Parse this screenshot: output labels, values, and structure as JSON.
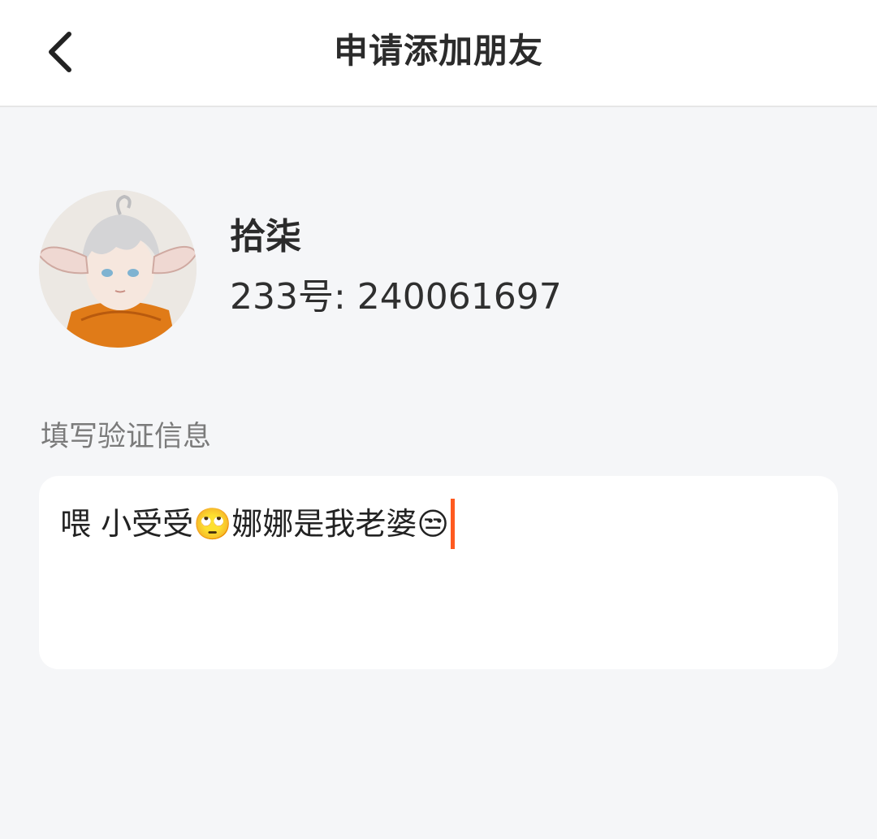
{
  "header": {
    "title": "申请添加朋友",
    "back_icon": "chevron-left-icon"
  },
  "profile": {
    "name": "拾柒",
    "id_text": "233号: 240061697",
    "avatar": "anime-avatar"
  },
  "verification": {
    "label": "填写验证信息",
    "value": "喂 小受受🙄娜娜是我老婆😒",
    "cursor_color": "#ff5a1f"
  },
  "colors": {
    "background": "#f5f6f8",
    "accent": "#ff5a1f"
  }
}
